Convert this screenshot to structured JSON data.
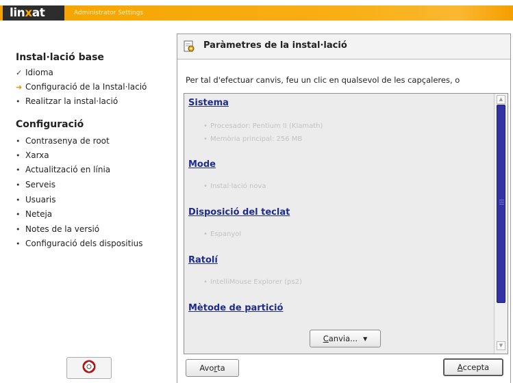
{
  "banner": {
    "logo_main": "lin",
    "logo_accent": "x",
    "logo_tail": "at",
    "title": "Administrator Settings"
  },
  "sidebar": {
    "section1_title": "Instal·lació base",
    "section1_items": [
      {
        "label": "Idioma",
        "state": "done"
      },
      {
        "label": "Configuració de la Instal·lació",
        "state": "current"
      },
      {
        "label": "Realitzar la instal·lació",
        "state": "pending"
      }
    ],
    "section2_title": "Configuració",
    "section2_items": [
      {
        "label": "Contrasenya de root"
      },
      {
        "label": "Xarxa"
      },
      {
        "label": "Actualització en línia"
      },
      {
        "label": "Serveis"
      },
      {
        "label": "Usuaris"
      },
      {
        "label": "Neteja"
      },
      {
        "label": "Notes de la versió"
      },
      {
        "label": "Configuració dels dispositius"
      }
    ]
  },
  "panel": {
    "title": "Paràmetres de la instal·lació",
    "instructions": "Per tal d'efectuar canvis, feu un clic en qualsevol de les capçaleres, o",
    "groups": [
      {
        "title": "Sistema",
        "items": [
          "Procesador: Pentium II (Klamath)",
          "Memòria principal: 256 MB"
        ]
      },
      {
        "title": "Mode",
        "items": [
          "Instal·lació nova"
        ]
      },
      {
        "title": "Disposició del teclat",
        "items": [
          "Espanyol"
        ]
      },
      {
        "title": "Ratolí",
        "items": [
          "IntelliMouse Explorer (ps2)"
        ]
      },
      {
        "title": "Mètode de partició",
        "items": []
      }
    ],
    "change_button": {
      "pre": "",
      "u": "C",
      "post": "anvia..."
    },
    "abort_button": {
      "pre": "Avo",
      "u": "r",
      "post": "ta"
    },
    "accept_button": {
      "pre": "",
      "u": "A",
      "post": "ccepta"
    }
  },
  "icons": {
    "panel_icon": "settings-document-icon",
    "help_icon": "lifebuoy-help-icon"
  },
  "colors": {
    "banner": "#f5a400",
    "group_title": "#1f2c8a",
    "scroll_thumb": "#3234a6",
    "current_arrow": "#f09000"
  }
}
